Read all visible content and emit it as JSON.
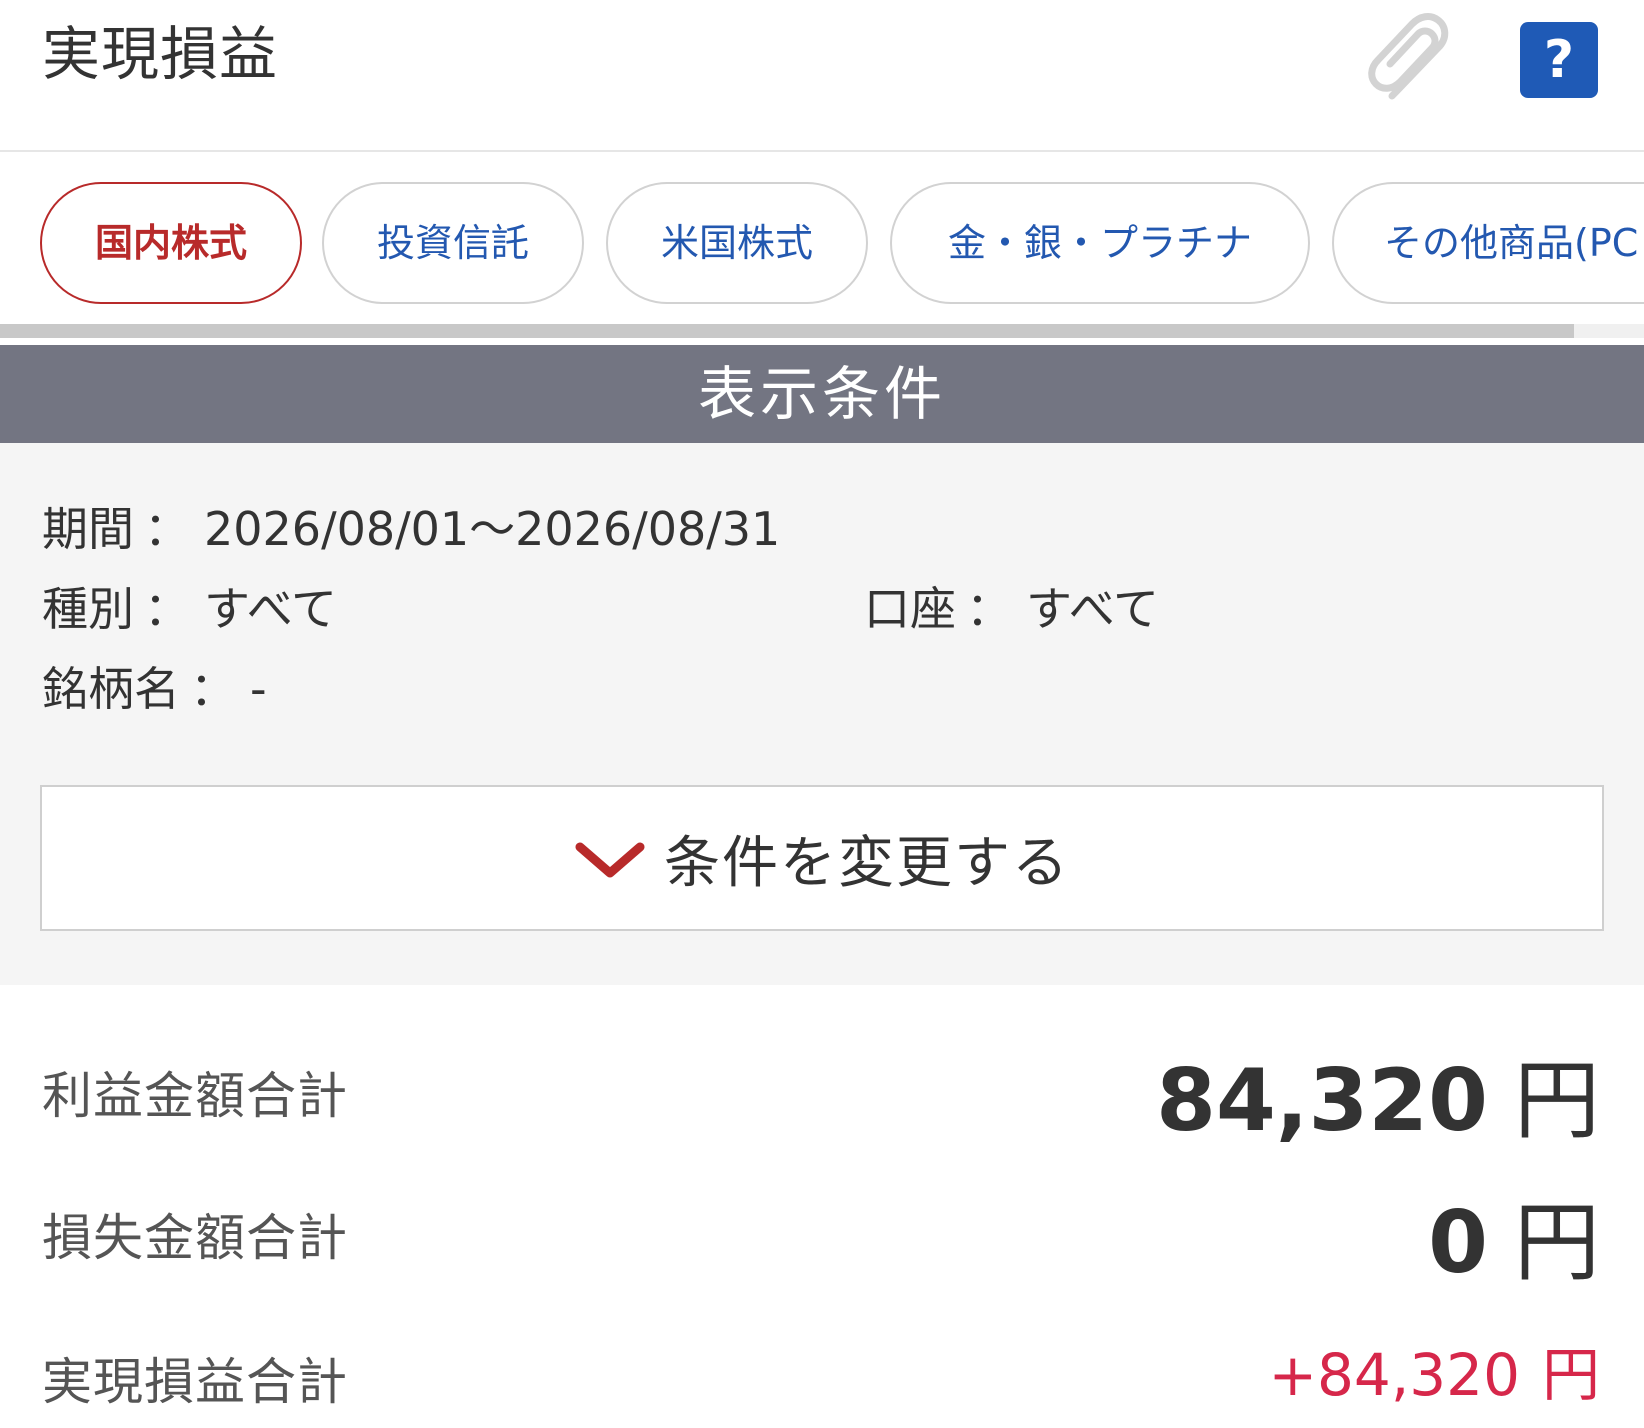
{
  "header": {
    "title": "実現損益",
    "clip_icon": "paperclip-icon",
    "help_label": "?"
  },
  "tabs": [
    {
      "label": "国内株式",
      "active": true
    },
    {
      "label": "投資信託",
      "active": false
    },
    {
      "label": "米国株式",
      "active": false
    },
    {
      "label": "金・銀・プラチナ",
      "active": false
    },
    {
      "label": "その他商品(PC",
      "active": false
    }
  ],
  "conditions": {
    "section_title": "表示条件",
    "period": {
      "label": "期間",
      "value": "2026/08/01～2026/08/31"
    },
    "type": {
      "label": "種別",
      "value": "すべて"
    },
    "account": {
      "label": "口座",
      "value": "すべて"
    },
    "issue": {
      "label": "銘柄名",
      "value": "-"
    },
    "separator": "：",
    "change_button": "条件を変更する"
  },
  "summary": {
    "profit": {
      "label": "利益金額合計",
      "value": "84,320",
      "unit": "円"
    },
    "loss": {
      "label": "損失金額合計",
      "value": "0",
      "unit": "円"
    },
    "total": {
      "label": "実現損益合計",
      "value": "+84,320",
      "unit": "円"
    }
  },
  "colors": {
    "accent_red": "#b82a2a",
    "link_blue": "#2358b0",
    "help_blue": "#1f5ab6",
    "section_gray": "#737582",
    "total_red": "#d6274a"
  }
}
